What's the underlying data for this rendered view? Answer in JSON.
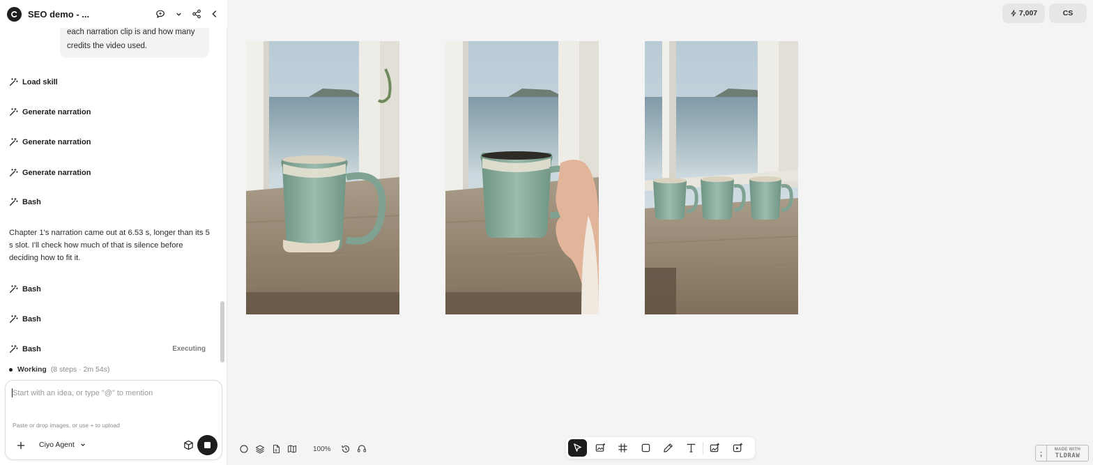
{
  "sidebar": {
    "project_title": "SEO demo - ...",
    "user_message_tail": "each narration clip is and how many credits the video used.",
    "steps": [
      {
        "label": "Load skill",
        "status": ""
      },
      {
        "label": "Generate narration",
        "status": ""
      },
      {
        "label": "Generate narration",
        "status": ""
      },
      {
        "label": "Generate narration",
        "status": ""
      },
      {
        "label": "Bash",
        "status": ""
      },
      {
        "label": "Bash",
        "status": ""
      },
      {
        "label": "Bash",
        "status": ""
      },
      {
        "label": "Bash",
        "status": "Executing"
      }
    ],
    "assistant_message": "Chapter 1's narration came out at 6.53 s, longer than its 5 s slot. I'll check how much of that is silence before deciding how to fit it.",
    "working": {
      "label": "Working",
      "meta": "(8 steps · 2m 54s)"
    },
    "composer": {
      "placeholder": "Start with an idea, or type \"@\" to mention",
      "value": "",
      "hint": "Paste or drop images, or use + to upload",
      "agent": "Ciyo Agent"
    }
  },
  "topbar": {
    "credits": "7,007",
    "user_initials": "CS"
  },
  "canvas": {
    "zoom": "100%",
    "frames": [
      {
        "subject": "single mug on windowsill"
      },
      {
        "subject": "hand holding mug"
      },
      {
        "subject": "three mugs on windowsill"
      }
    ],
    "tools": [
      "select-tool",
      "image-gen-tool",
      "frame-tool",
      "rectangle-tool",
      "draw-tool",
      "text-tool",
      "add-image-tool",
      "add-video-tool"
    ],
    "active_tool": "select-tool",
    "watermark": {
      "line1": "MADE WITH",
      "line2": "TLDRAW"
    }
  },
  "colors": {
    "accent": "#1d1d1d",
    "panel": "#ffffff",
    "canvas_bg": "#f4f4f4",
    "mug_glaze": "#8fb0a0"
  },
  "icons": [
    "logo-icon",
    "comment-icon",
    "chevron-down-icon",
    "share-icon",
    "collapse-left-icon",
    "wand-icon",
    "plus-icon",
    "cube-icon",
    "stop-icon",
    "bolt-icon"
  ]
}
